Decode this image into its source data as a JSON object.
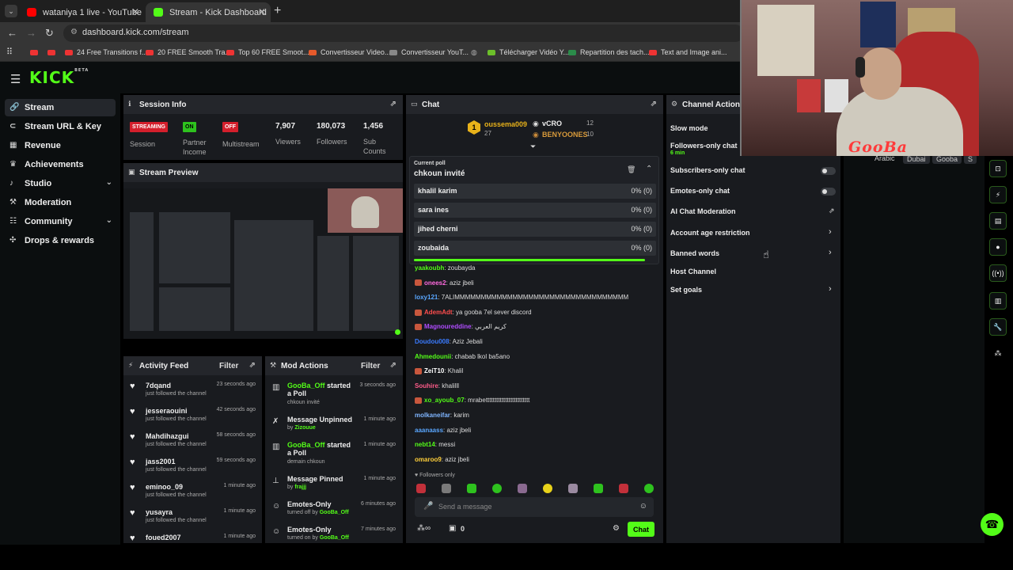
{
  "browser": {
    "tabs": [
      {
        "title": "wataniya 1 live - YouTube"
      },
      {
        "title": "Stream - Kick Dashboard"
      }
    ],
    "url": "dashboard.kick.com/stream",
    "bookmarks": [
      "24 Free Transitions f...",
      "20 FREE Smooth Tra...",
      "Top 60 FREE Smoot...",
      "Convertisseur Video...",
      "Convertisseur YouT...",
      "Télécharger Vidéo Y...",
      "Repartition des tach...",
      "Text and Image ani..."
    ]
  },
  "header": {
    "logo": "KICK",
    "logo_sup": "BETA"
  },
  "sidebar": {
    "items": [
      {
        "label": "Stream",
        "icon": "link-icon"
      },
      {
        "label": "Stream URL & Key",
        "icon": "key-icon"
      },
      {
        "label": "Revenue",
        "icon": "bank-icon"
      },
      {
        "label": "Achievements",
        "icon": "trophy-icon"
      },
      {
        "label": "Studio",
        "icon": "studio-icon"
      },
      {
        "label": "Moderation",
        "icon": "hammer-icon"
      },
      {
        "label": "Community",
        "icon": "community-icon"
      },
      {
        "label": "Drops & rewards",
        "icon": "gift-icon"
      }
    ]
  },
  "session": {
    "title": "Session Info",
    "badges": {
      "streaming": "STREAMING",
      "on": "ON",
      "off": "OFF"
    },
    "labels": {
      "session": "Session",
      "partner": "Partner Income",
      "multistream": "Multistream",
      "viewers": "Viewers",
      "followers": "Followers",
      "subs": "Sub Counts"
    },
    "values": {
      "viewers": "7,907",
      "followers": "180,073",
      "subs": "1,456"
    }
  },
  "preview": {
    "title": "Stream Preview"
  },
  "activity": {
    "title": "Activity Feed",
    "filter": "Filter",
    "items": [
      {
        "name": "7dqand",
        "text": "just followed the channel",
        "time": "23 seconds ago"
      },
      {
        "name": "jesseraouini",
        "text": "just followed the channel",
        "time": "42 seconds ago"
      },
      {
        "name": "Mahdihazgui",
        "text": "just followed the channel",
        "time": "58 seconds ago"
      },
      {
        "name": "jass2001",
        "text": "just followed the channel",
        "time": "59 seconds ago"
      },
      {
        "name": "eminoo_09",
        "text": "just followed the channel",
        "time": "1 minute ago"
      },
      {
        "name": "yusayra",
        "text": "just followed the channel",
        "time": "1 minute ago"
      },
      {
        "name": "foued2007",
        "text": "",
        "time": "1 minute ago"
      }
    ]
  },
  "mod": {
    "title": "Mod Actions",
    "filter": "Filter",
    "items": [
      {
        "actor": "GooBa_Off",
        "action": " started a Poll",
        "sub": "chkoun invité",
        "time": "3 seconds ago"
      },
      {
        "actor": "",
        "action": "Message Unpinned",
        "sub_prefix": "by ",
        "sub_user": "Zizouue",
        "time": "1 minute ago"
      },
      {
        "actor": "GooBa_Off",
        "action": " started a Poll",
        "sub": "demain chkoun",
        "time": "1 minute ago"
      },
      {
        "actor": "",
        "action": "Message Pinned",
        "sub_prefix": "by ",
        "sub_user": "frajjj",
        "time": "1 minute ago"
      },
      {
        "actor": "",
        "action": "Emotes-Only",
        "sub_prefix": "turned off by ",
        "sub_user": "GooBa_Off",
        "time": "6 minutes ago"
      },
      {
        "actor": "",
        "action": "Emotes-Only",
        "sub_prefix": "turned on by ",
        "sub_user": "GooBa_Off",
        "time": "7 minutes ago"
      }
    ]
  },
  "chat": {
    "title": "Chat",
    "leaders": [
      {
        "name": "oussema009",
        "count": "27"
      },
      {
        "name": "vCRO",
        "count": "12"
      },
      {
        "name": "BENYOONES",
        "count": "10"
      }
    ],
    "poll": {
      "label": "Current poll",
      "question": "chkoun invité",
      "options": [
        {
          "name": "khalil karim",
          "pct": "0% (0)"
        },
        {
          "name": "sara ines",
          "pct": "0% (0)"
        },
        {
          "name": "jihed cherni",
          "pct": "0% (0)"
        },
        {
          "name": "zoubaida",
          "pct": "0% (0)"
        }
      ]
    },
    "messages": [
      {
        "user": "yaakoubh",
        "color": "#53fc18",
        "text": ": zoubayda",
        "badge": false
      },
      {
        "user": "onees2",
        "color": "#ff6adf",
        "text": ": aziz jbeli",
        "badge": true
      },
      {
        "user": "loxy121",
        "color": "#5aa7ff",
        "text": ": 7ALIMMMMMMMMMMMMMMMMMMMMMMMMMMMMMMMMM",
        "badge": false
      },
      {
        "user": "AdemAdt",
        "color": "#ff4d4d",
        "text": ": ya gooba 7el sever discord",
        "badge": true
      },
      {
        "user": "Magnoureddine",
        "color": "#b04cff",
        "text": ": كريم العربي",
        "badge": true
      },
      {
        "user": "Doudou008",
        "color": "#3a7bff",
        "text": ": Aziz Jebali",
        "badge": false
      },
      {
        "user": "Ahmedounii",
        "color": "#53fc18",
        "text": ": chabab lkol ba5ano",
        "badge": false
      },
      {
        "user": "ZeiT10",
        "color": "#ffffff",
        "text": ": Khalil",
        "badge": true
      },
      {
        "user": "Souhire",
        "color": "#ff5c8a",
        "text": ": khalilll",
        "badge": false
      },
      {
        "user": "xo_ayoub_07",
        "color": "#53fc18",
        "text": ": mrabettttttttttttttttttttttttt",
        "badge": true
      },
      {
        "user": "molkaneifar",
        "color": "#7fb5ff",
        "text": ": karim",
        "badge": false
      },
      {
        "user": "aaanaass",
        "color": "#5aa7ff",
        "text": ": aziz jbeli",
        "badge": false
      },
      {
        "user": "nebt14",
        "color": "#53fc18",
        "text": ": messi",
        "badge": false
      },
      {
        "user": "omaroo9",
        "color": "#ffcf3a",
        "text": ": aziz jbeli",
        "badge": false
      }
    ],
    "followers_only": "Followers only",
    "placeholder": "Send a message",
    "count": "0",
    "send": "Chat"
  },
  "channel_actions": {
    "title": "Channel Actions",
    "items": [
      {
        "label": "Slow mode"
      },
      {
        "label": "Followers-only chat",
        "sub": "6 min"
      },
      {
        "label": "Subscribers-only chat"
      },
      {
        "label": "Emotes-only chat"
      },
      {
        "label": "AI Chat Moderation"
      },
      {
        "label": "Account age restriction"
      },
      {
        "label": "Banned words"
      },
      {
        "label": "Host Channel"
      },
      {
        "label": "Set goals"
      }
    ]
  },
  "tags": [
    "Arabic",
    "Dubai",
    "Gooba",
    "S"
  ],
  "cam": {
    "name": "GooBa"
  }
}
